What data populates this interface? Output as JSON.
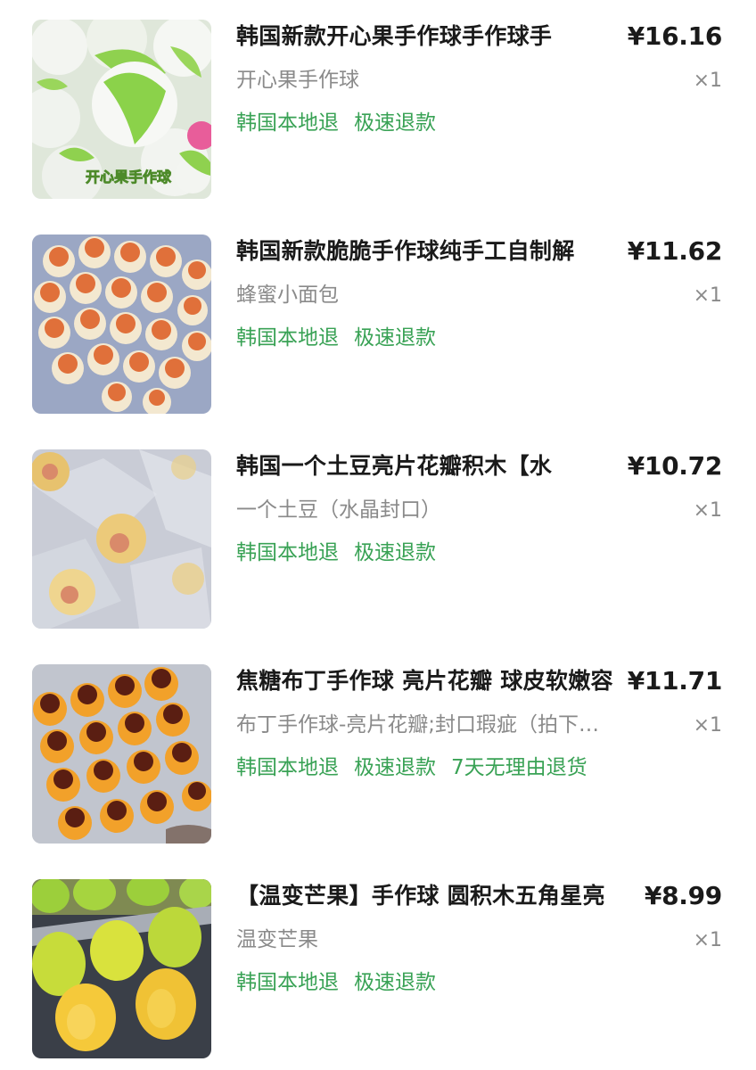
{
  "order": {
    "items": [
      {
        "title": "韩国新款开心果手作球手作球手",
        "price": "¥16.16",
        "variant": "开心果手作球",
        "quantity": "×1",
        "tags": [
          "韩国本地退",
          "极速退款"
        ],
        "image_overlay_text": "开心果手作球",
        "colors": {
          "primary": "#8fd14f",
          "secondary": "#f4f6f2",
          "accent": "#e85d9a"
        }
      },
      {
        "title": "韩国新款脆脆手作球纯手工自制解",
        "price": "¥11.62",
        "variant": "蜂蜜小面包",
        "quantity": "×1",
        "tags": [
          "韩国本地退",
          "极速退款"
        ],
        "colors": {
          "primary": "#e0703a",
          "secondary": "#f3e8d0",
          "accent": "#9ba7c4"
        }
      },
      {
        "title": "韩国一个土豆亮片花瓣积木【水",
        "price": "¥10.72",
        "variant": "一个土豆（水晶封口）",
        "quantity": "×1",
        "tags": [
          "韩国本地退",
          "极速退款"
        ],
        "colors": {
          "primary": "#e7c26e",
          "secondary": "#c9ccd6",
          "accent": "#d98a6a"
        }
      },
      {
        "title": "焦糖布丁手作球 亮片花瓣 球皮软嫩容",
        "price": "¥11.71",
        "variant": "布丁手作球-亮片花瓣;封口瑕疵（拍下…",
        "quantity": "×1",
        "tags": [
          "韩国本地退",
          "极速退款",
          "7天无理由退货"
        ],
        "colors": {
          "primary": "#f2a12a",
          "secondary": "#5a1e12",
          "accent": "#b9bec8"
        }
      },
      {
        "title": "【温变芒果】手作球 圆积木五角星亮",
        "price": "¥8.99",
        "variant": "温变芒果",
        "quantity": "×1",
        "tags": [
          "韩国本地退",
          "极速退款"
        ],
        "colors": {
          "primary": "#f5c93a",
          "secondary": "#9ccf3b",
          "accent": "#3a3f48"
        }
      }
    ]
  }
}
